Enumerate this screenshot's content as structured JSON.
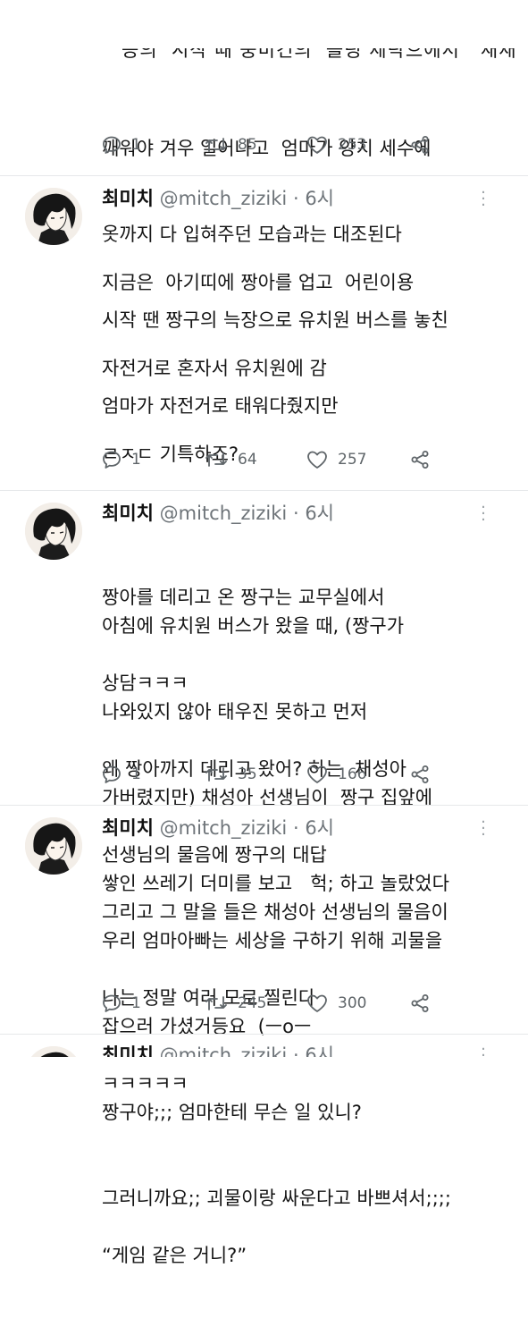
{
  "tweets": [
    {
      "partial_top": true,
      "lines": [
        "깨워야 겨우 일어나고  엄마가 양치 세수에",
        "옷까지 다 입혀주던 모습과는 대조된다",
        "시작 땐 짱구의 늑장으로 유치원 버스를 놓친",
        "엄마가 자전거로 태워다줬지만"
      ],
      "replies": "1",
      "retweets": "85",
      "likes": "253"
    },
    {
      "name": "최미치",
      "handle": "@mitch_ziziki",
      "dot": "·",
      "time": "6시",
      "lines": [
        "지금은  아기띠에 짱아를 업고  어린이용",
        "자전거로 혼자서 유치원에 감",
        "ㄹㅈㄷ 기특하죠?",
        "",
        "아침에 유치원 버스가 왔을 때, (짱구가",
        "나와있지 않아 태우진 못하고 먼저",
        "가버렸지만) 채성아 선생님이  짱구 집앞에",
        "쌓인 쓰레기 더미를 보고   헉; 하고 놀랐었다"
      ],
      "replies": "1",
      "retweets": "64",
      "likes": "257"
    },
    {
      "name": "최미치",
      "handle": "@mitch_ziziki",
      "dot": "·",
      "time": "6시",
      "lines": [
        "짱아를 데리고 온 짱구는 교무실에서",
        "상담ㅋㅋㅋ",
        "왜 짱아까지 데리고 왔어? 하는  채성아",
        "선생님의 물음에 짱구의 대답",
        "우리 엄마아빠는 세상을 구하기 위해 괴물을",
        "잡으러 가셨거등요  (ㅡoㅡ",
        "짱구야;;; 엄마한테 무슨 일 있니?",
        "그러니까요;; 괴물이랑 싸운다고 바쁘셔서;;;;"
      ],
      "replies": "1",
      "retweets": "35",
      "likes": "166"
    },
    {
      "name": "최미치",
      "handle": "@mitch_ziziki",
      "dot": "·",
      "time": "6시",
      "lines": [
        "그리고 그 말을 들은 채성아 선생님의 물음이",
        "나는 정말 여러 모로 찔린다",
        "ㅋㅋㅋㅋㅋ",
        "",
        "“게임 같은 거니?”"
      ],
      "replies": "1",
      "retweets": "245",
      "likes": "300"
    },
    {
      "name": "최미치",
      "handle": "@mitch_ziziki",
      "dot": "·",
      "time": "6시",
      "partial_bottom": true
    }
  ],
  "icons": {
    "reply": "reply-icon",
    "retweet": "retweet-icon",
    "like": "heart-icon",
    "share": "share-icon",
    "menu": "more-vertical-icon"
  },
  "colors": {
    "text": "#151515",
    "muted": "#6e7479",
    "icon": "#5f6569",
    "divider": "#e6e8ea"
  }
}
